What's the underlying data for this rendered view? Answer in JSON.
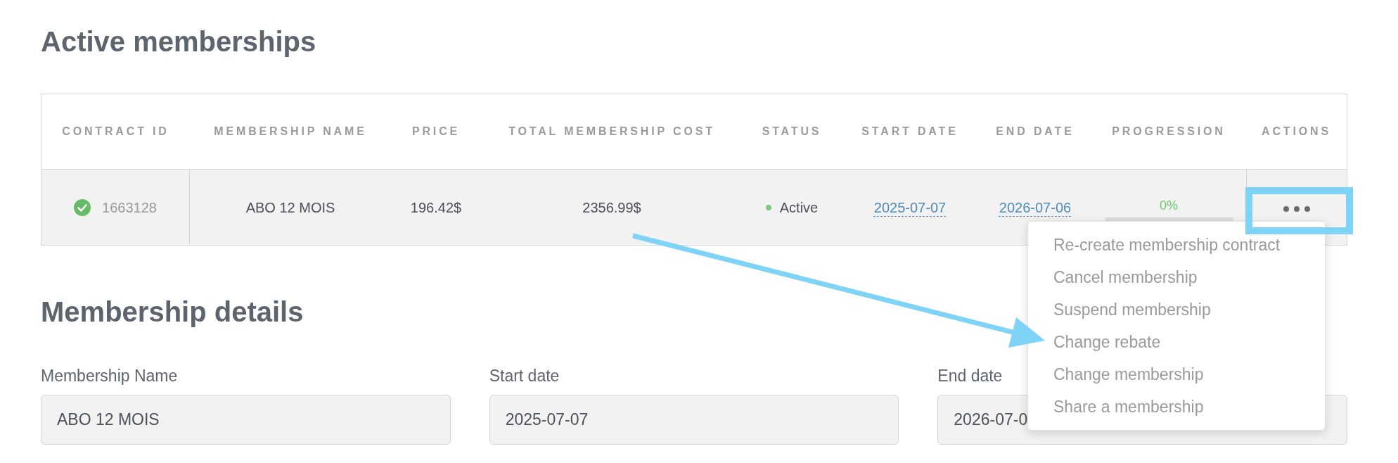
{
  "active_memberships": {
    "title": "Active memberships",
    "table": {
      "columns": [
        "CONTRACT ID",
        "MEMBERSHIP NAME",
        "PRICE",
        "TOTAL MEMBERSHIP COST",
        "STATUS",
        "START DATE",
        "END DATE",
        "PROGRESSION",
        "ACTIONS"
      ],
      "rows": [
        {
          "contract_id": "1663128",
          "verified": true,
          "membership_name": "ABO 12 MOIS",
          "price": "196.42$",
          "total_membership_cost": "2356.99$",
          "status": {
            "label": "Active",
            "color": "#7ccb7c"
          },
          "start_date": "2025-07-07",
          "end_date": "2026-07-06",
          "progression": {
            "label": "0%",
            "level": 0
          },
          "actions": {
            "menu_open": true,
            "menu": [
              "Re-create membership contract",
              "Cancel membership",
              "Suspend membership",
              "Change rebate",
              "Change membership",
              "Share a membership"
            ]
          }
        }
      ]
    }
  },
  "membership_details": {
    "title": "Membership details",
    "fields": [
      {
        "label": "Membership Name",
        "value": "ABO 12 MOIS"
      },
      {
        "label": "Start date",
        "value": "2025-07-07"
      },
      {
        "label": "End date",
        "value": "2026-07-0"
      }
    ]
  }
}
